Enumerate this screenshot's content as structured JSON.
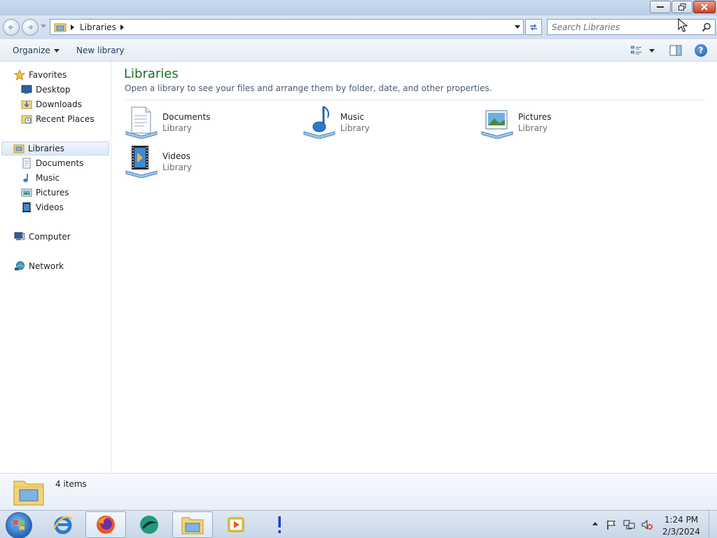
{
  "window": {
    "minimize_label": "Minimize",
    "maximize_label": "Restore",
    "close_label": "Close"
  },
  "address": {
    "breadcrumb": [
      "Libraries"
    ],
    "search_placeholder": "Search Libraries"
  },
  "toolbar": {
    "organize_label": "Organize",
    "new_library_label": "New library"
  },
  "nav": {
    "favorites": {
      "label": "Favorites",
      "items": [
        {
          "label": "Desktop",
          "icon": "desktop-icon"
        },
        {
          "label": "Downloads",
          "icon": "downloads-icon"
        },
        {
          "label": "Recent Places",
          "icon": "recent-places-icon"
        }
      ]
    },
    "libraries": {
      "label": "Libraries",
      "items": [
        {
          "label": "Documents",
          "icon": "documents-icon"
        },
        {
          "label": "Music",
          "icon": "music-icon"
        },
        {
          "label": "Pictures",
          "icon": "pictures-icon"
        },
        {
          "label": "Videos",
          "icon": "videos-icon"
        }
      ]
    },
    "computer_label": "Computer",
    "network_label": "Network"
  },
  "content": {
    "title": "Libraries",
    "description": "Open a library to see your files and arrange them by folder, date, and other properties.",
    "items": [
      {
        "name": "Documents",
        "type": "Library",
        "icon": "documents-library-icon"
      },
      {
        "name": "Music",
        "type": "Library",
        "icon": "music-library-icon"
      },
      {
        "name": "Pictures",
        "type": "Library",
        "icon": "pictures-library-icon"
      },
      {
        "name": "Videos",
        "type": "Library",
        "icon": "videos-library-icon"
      }
    ]
  },
  "details": {
    "count_label": "4 items"
  },
  "taskbar": {
    "apps": [
      "internet-explorer-icon",
      "firefox-icon",
      "app-icon",
      "windows-explorer-icon",
      "media-player-icon",
      "alert-icon"
    ],
    "time": "1:24 PM",
    "date": "2/3/2024"
  },
  "colors": {
    "title_green": "#1e6c2b",
    "toolbar_text": "#1e3a5f",
    "selection": "#dde8f6"
  }
}
